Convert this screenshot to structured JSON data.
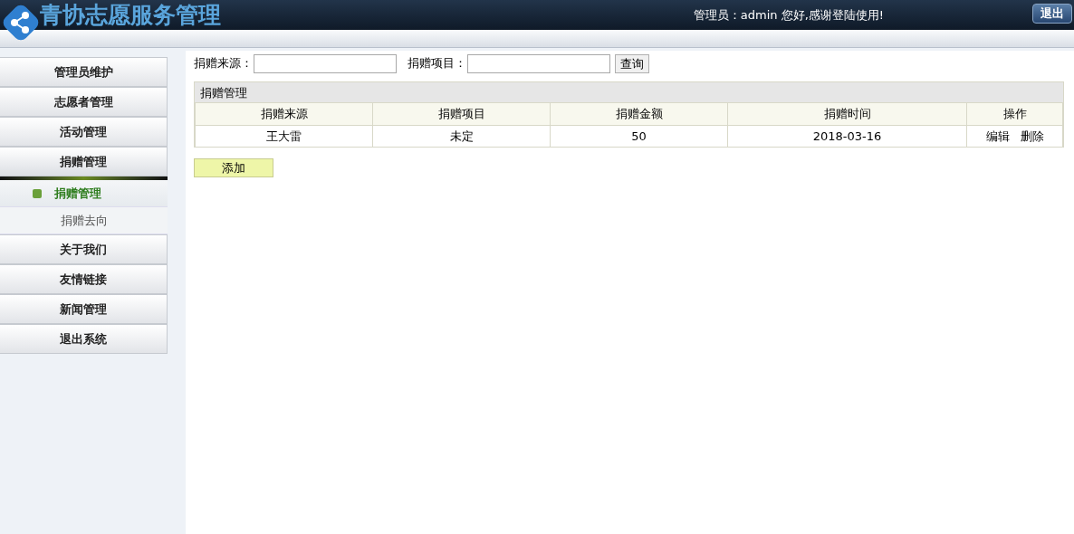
{
  "header": {
    "title": "青协志愿服务管理",
    "greeting": "管理员：admin 您好,感谢登陆使用!",
    "logout": "退出"
  },
  "sidebar": {
    "items": [
      {
        "label": "管理员维护"
      },
      {
        "label": "志愿者管理"
      },
      {
        "label": "活动管理"
      },
      {
        "label": "捐赠管理",
        "expanded": true,
        "children": [
          {
            "label": "捐赠管理",
            "selected": true
          },
          {
            "label": "捐赠去向",
            "selected": false
          }
        ]
      },
      {
        "label": "关于我们"
      },
      {
        "label": "友情链接"
      },
      {
        "label": "新闻管理"
      },
      {
        "label": "退出系统"
      }
    ]
  },
  "search": {
    "fields": [
      {
        "label": "捐赠来源："
      },
      {
        "label": "捐赠项目："
      }
    ],
    "button": "查询"
  },
  "table": {
    "caption": "捐赠管理",
    "columns": [
      "捐赠来源",
      "捐赠项目",
      "捐赠金额",
      "捐赠时间",
      "操作"
    ],
    "rows": [
      {
        "cells": [
          "王大雷",
          "未定",
          "50",
          "2018-03-16"
        ],
        "actions": [
          "编辑",
          "删除"
        ]
      }
    ]
  },
  "add_button": "添加"
}
